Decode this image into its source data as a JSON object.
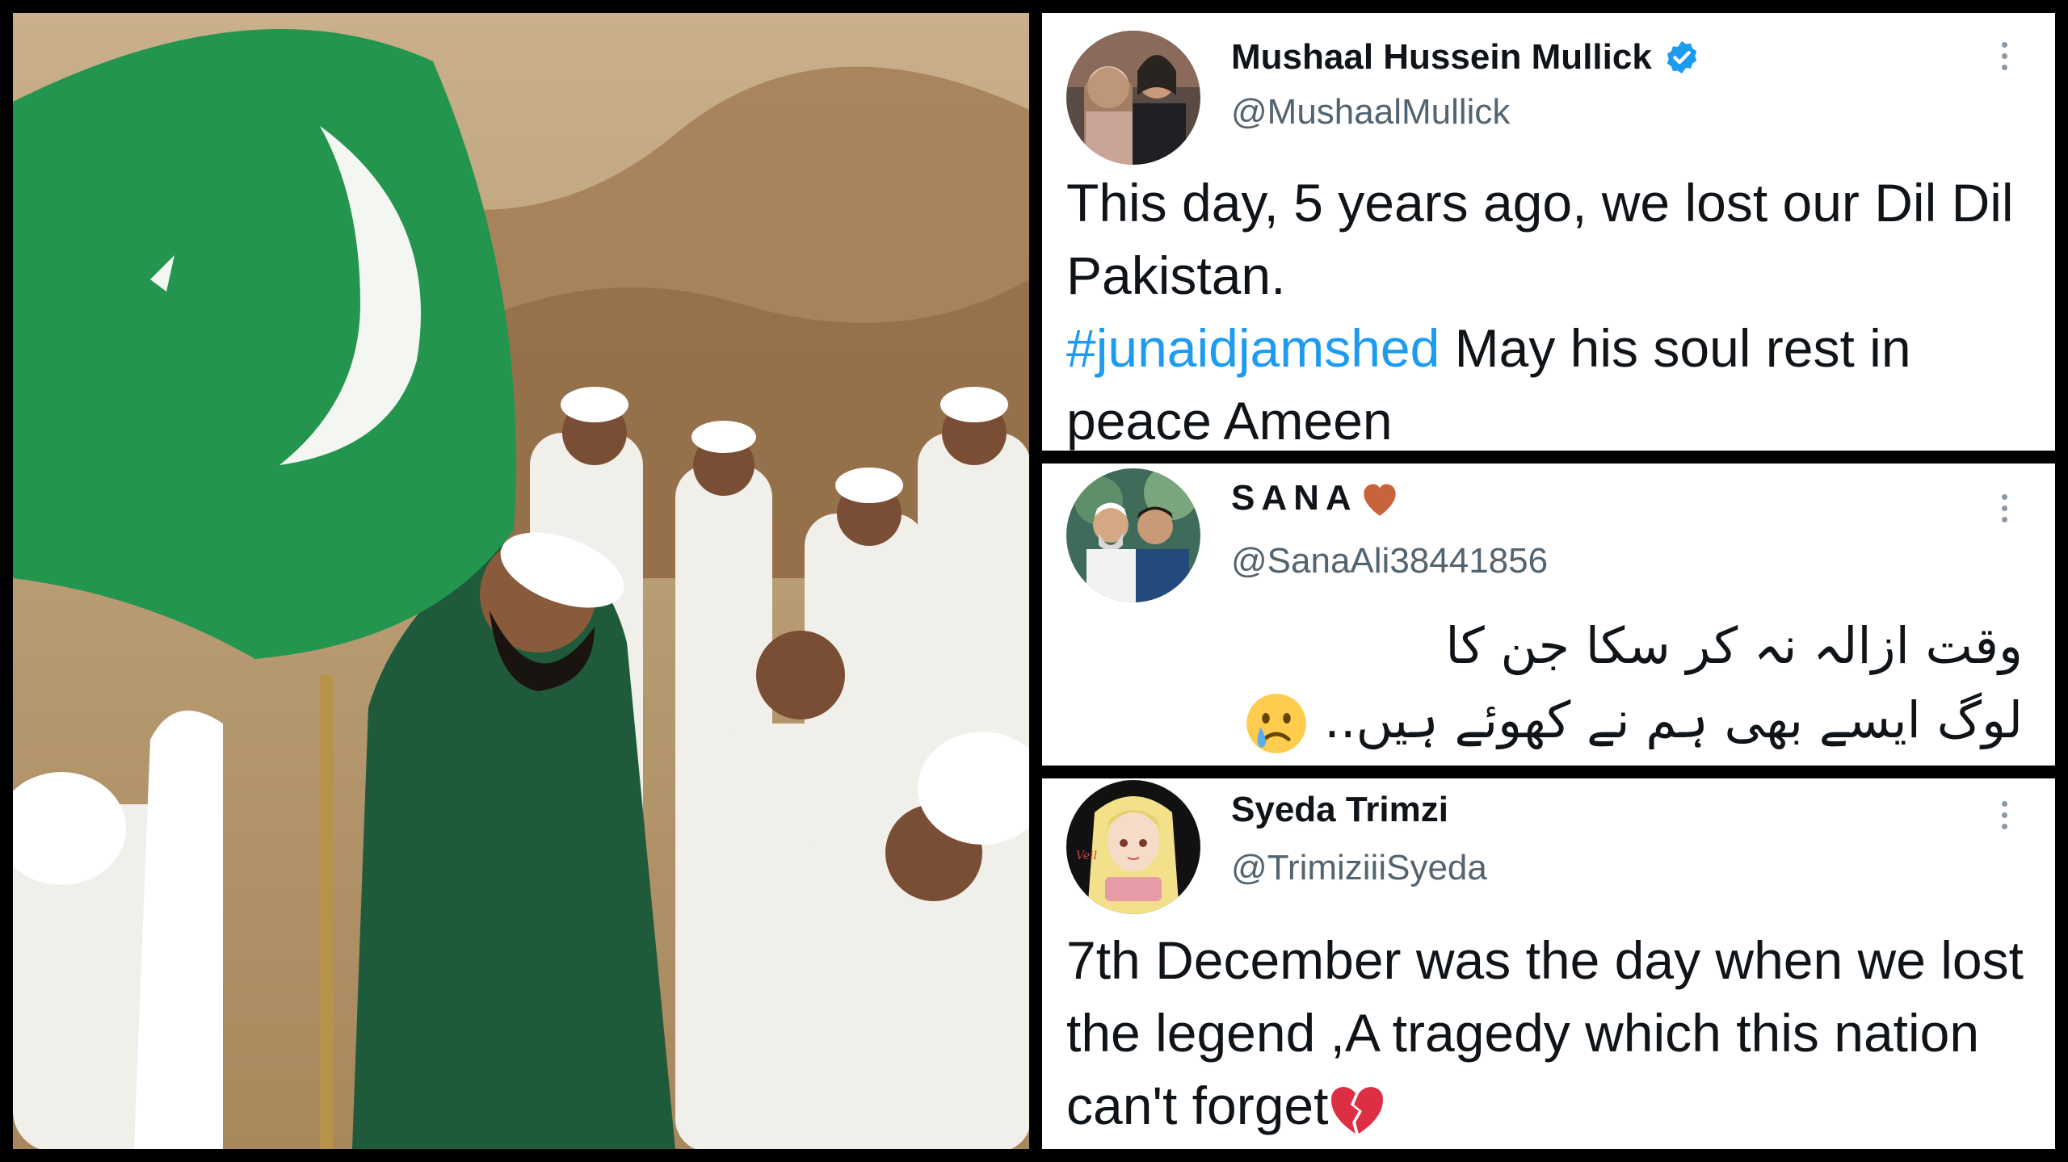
{
  "photo": {
    "alt_icon": "photo-pakistan-flag-crowd"
  },
  "tweets": [
    {
      "name": "Mushaal Hussein Mullick",
      "verified": true,
      "handle": "@MushaalMullick",
      "text_before": "This day, 5 years ago, we lost our Dil Dil Pakistan.",
      "hashtag": "#junaidjamshed",
      "text_after": " May his soul rest in peace Ameen"
    },
    {
      "name": "SANA",
      "name_emoji": "orange-heart-icon",
      "handle": "@SanaAli38441856",
      "urdu_line1": "وقت ازالہ نہ کر سکا جن کا",
      "urdu_line2": "لوگ ایسے بھی ہم نے کھوئے ہیں..",
      "urdu_emoji": "crying-face-icon"
    },
    {
      "name": "Syeda Trimzi",
      "handle": "@TrimiziiiSyeda",
      "text": "7th December was the day when we lost the legend ,A tragedy which this nation can't forget",
      "text_emoji": "broken-heart-icon"
    }
  ],
  "colors": {
    "hashtag": "#1d9bf0",
    "handle": "#536471",
    "verified": "#1d9bf0"
  }
}
